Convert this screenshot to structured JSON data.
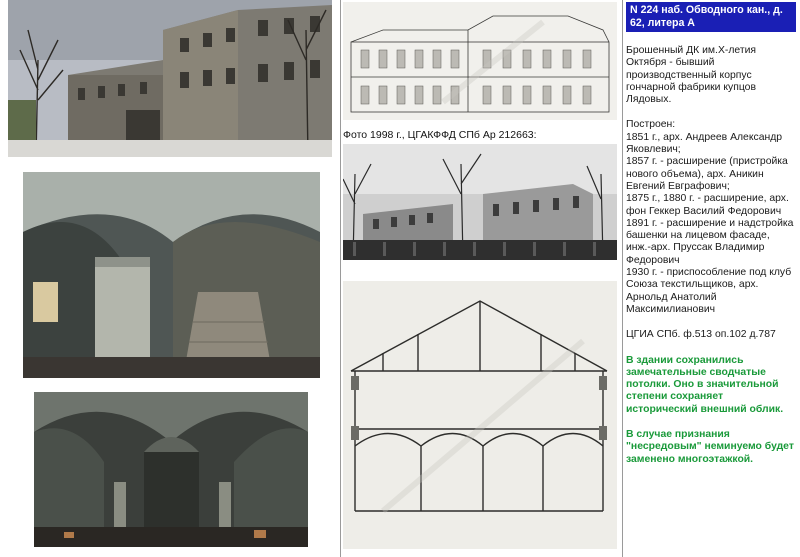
{
  "header": {
    "address": "N 224 наб. Обводного кан., д. 62, литера А"
  },
  "description": "Брошенный ДК им.Х-летия Октября - бывший производственный корпус гончарной фабрики купцов Лядовых.",
  "history": {
    "label": "Построен:",
    "entries": [
      "1851 г., арх. Андреев Александр Яковлевич;",
      "1857 г. - расширение (пристройка нового объема), арх. Аникин Евгений Евграфович;",
      "1875 г., 1880 г. - расширение, арх. фон Геккер Василий Федорович",
      "1891 г. - расширение и надстройка башенки на лицевом фасаде, инж.-арх. Пруссак Владимир Федорович",
      "1930 г. - приспособление под клуб Союза текстильщиков, арх. Арнольд Анатолий Максимилианович"
    ]
  },
  "archive_ref": "ЦГИА СПб. ф.513 оп.102 д.787",
  "note1": "В здании сохранились замечательные сводчатые потолки. Оно в значительной степени сохраняет исторический внешний облик.",
  "note2": "В случае признания \"несредовым\" неминуемо будет заменено многоэтажкой.",
  "photo_caption": "Фото 1998 г., ЦГАКФФД СПб Ар 212663:",
  "watermark": "spbarchives.ru"
}
